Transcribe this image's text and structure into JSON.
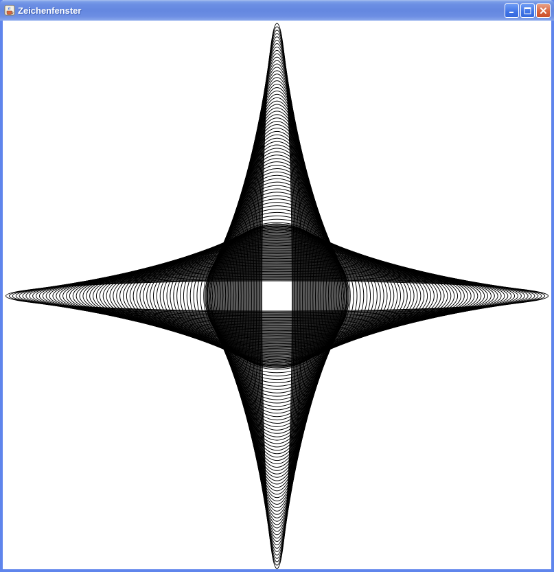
{
  "window": {
    "title": "Zeichenfenster",
    "app_icon": "java-cup-icon",
    "buttons": [
      {
        "name": "minimize",
        "icon": "minimize-icon"
      },
      {
        "name": "maximize",
        "icon": "maximize-icon"
      },
      {
        "name": "close",
        "icon": "close-icon"
      }
    ]
  },
  "colors": {
    "titlebar": "#6487e0",
    "frame": "#5f85ec",
    "canvas_bg": "#ffffff",
    "stroke": "#000000",
    "close_button": "#d9653f"
  },
  "drawing": {
    "shape": "nested-ellipses",
    "horizontal_ellipse_count": 62,
    "vertical_ellipse_count": 62
  }
}
